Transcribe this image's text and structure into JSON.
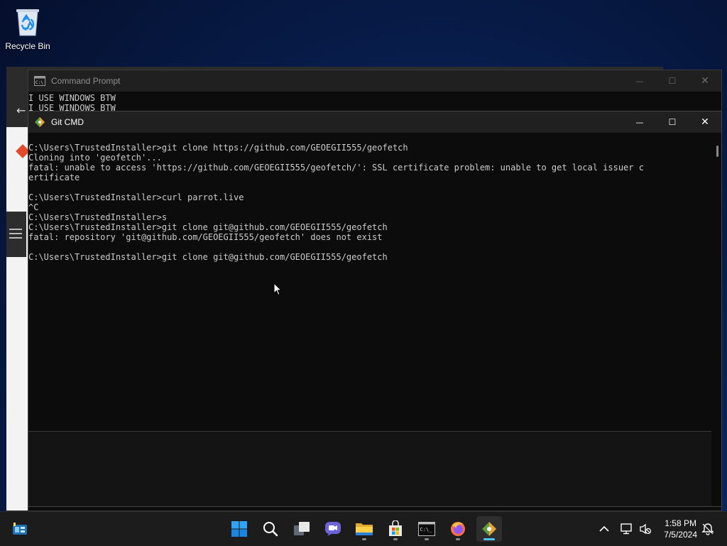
{
  "desktop": {
    "icons": [
      {
        "label": "Recycle Bin",
        "icon": "recycle-bin-icon"
      }
    ]
  },
  "command_prompt": {
    "title": "Command Prompt",
    "lines": [
      "I USE WINDOWS BTW",
      "I USE WINDOWS BTW"
    ]
  },
  "git_cmd": {
    "title": "Git CMD",
    "lines": [
      "",
      "C:\\Users\\TrustedInstaller>git clone https://github.com/GEOEGII555/geofetch",
      "Cloning into 'geofetch'...",
      "fatal: unable to access 'https://github.com/GEOEGII555/geofetch/': SSL certificate problem: unable to get local issuer c",
      "ertificate",
      "",
      "C:\\Users\\TrustedInstaller>curl parrot.live",
      "^C",
      "C:\\Users\\TrustedInstaller>s",
      "C:\\Users\\TrustedInstaller>git clone git@github.com/GEOEGII555/geofetch",
      "fatal: repository 'git@github.com/GEOEGII555/geofetch' does not exist",
      "",
      "C:\\Users\\TrustedInstaller>git clone git@github.com/GEOEGII555/geofetch"
    ]
  },
  "window_buttons": {
    "minimize": "—",
    "maximize": "☐",
    "close": "✕"
  },
  "taskbar": {
    "items": [
      {
        "name": "start",
        "icon": "windows-start-icon"
      },
      {
        "name": "search",
        "icon": "search-icon"
      },
      {
        "name": "task-view",
        "icon": "task-view-icon"
      },
      {
        "name": "chat",
        "icon": "chat-icon"
      },
      {
        "name": "file-explorer",
        "icon": "folder-icon"
      },
      {
        "name": "store",
        "icon": "store-icon"
      },
      {
        "name": "terminal",
        "icon": "terminal-icon"
      },
      {
        "name": "firefox",
        "icon": "firefox-icon"
      },
      {
        "name": "git-cmd",
        "icon": "git-icon"
      }
    ],
    "tray": {
      "time": "1:58 PM",
      "date": "7/5/2024"
    }
  },
  "colors": {
    "terminal_bg": "#0c0c0c",
    "terminal_fg": "#cccccc",
    "titlebar_bg": "#202020",
    "taskbar_bg": "#1c1c1c",
    "accent": "#4cc2ff"
  }
}
